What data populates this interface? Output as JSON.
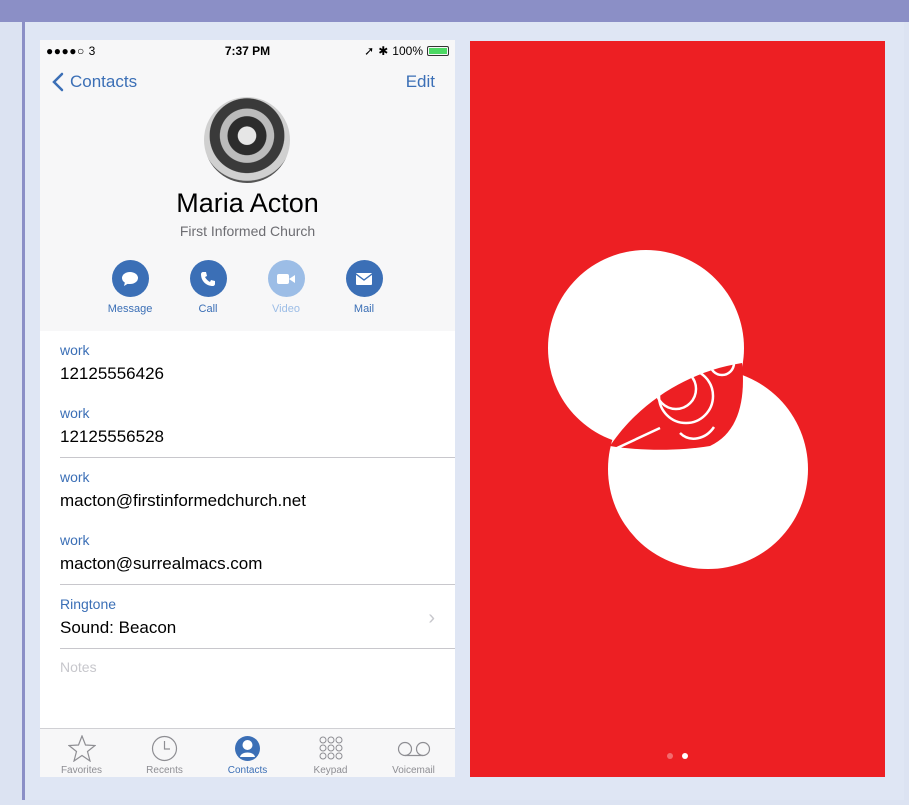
{
  "status_bar": {
    "signal": "●●●●○ 3",
    "time": "7:37 PM",
    "battery": "100%"
  },
  "nav": {
    "back_label": "Contacts",
    "edit_label": "Edit"
  },
  "contact": {
    "name": "Maria Acton",
    "company": "First Informed Church"
  },
  "actions": [
    {
      "label": "Message",
      "icon": "message-icon",
      "enabled": true
    },
    {
      "label": "Call",
      "icon": "phone-icon",
      "enabled": true
    },
    {
      "label": "Video",
      "icon": "video-icon",
      "enabled": false
    },
    {
      "label": "Mail",
      "icon": "mail-icon",
      "enabled": true
    }
  ],
  "fields": [
    {
      "label": "work",
      "value": "12125556426"
    },
    {
      "label": "work",
      "value": "12125556528"
    },
    {
      "label": "work",
      "value": "macton@firstinformedchurch.net"
    },
    {
      "label": "work",
      "value": "macton@surrealmacs.com"
    },
    {
      "label": "Ringtone",
      "value": "Sound: Beacon"
    }
  ],
  "notes_placeholder": "Notes",
  "tabs": [
    {
      "label": "Favorites",
      "icon": "star-icon"
    },
    {
      "label": "Recents",
      "icon": "clock-icon"
    },
    {
      "label": "Contacts",
      "icon": "person-icon",
      "active": true
    },
    {
      "label": "Keypad",
      "icon": "keypad-icon"
    },
    {
      "label": "Voicemail",
      "icon": "voicemail-icon"
    }
  ],
  "splash": {
    "page_count": 2,
    "current_page": 2
  },
  "colors": {
    "accent": "#3b6fb6",
    "splash_red": "#ed1f23",
    "battery_green": "#4cd964"
  }
}
